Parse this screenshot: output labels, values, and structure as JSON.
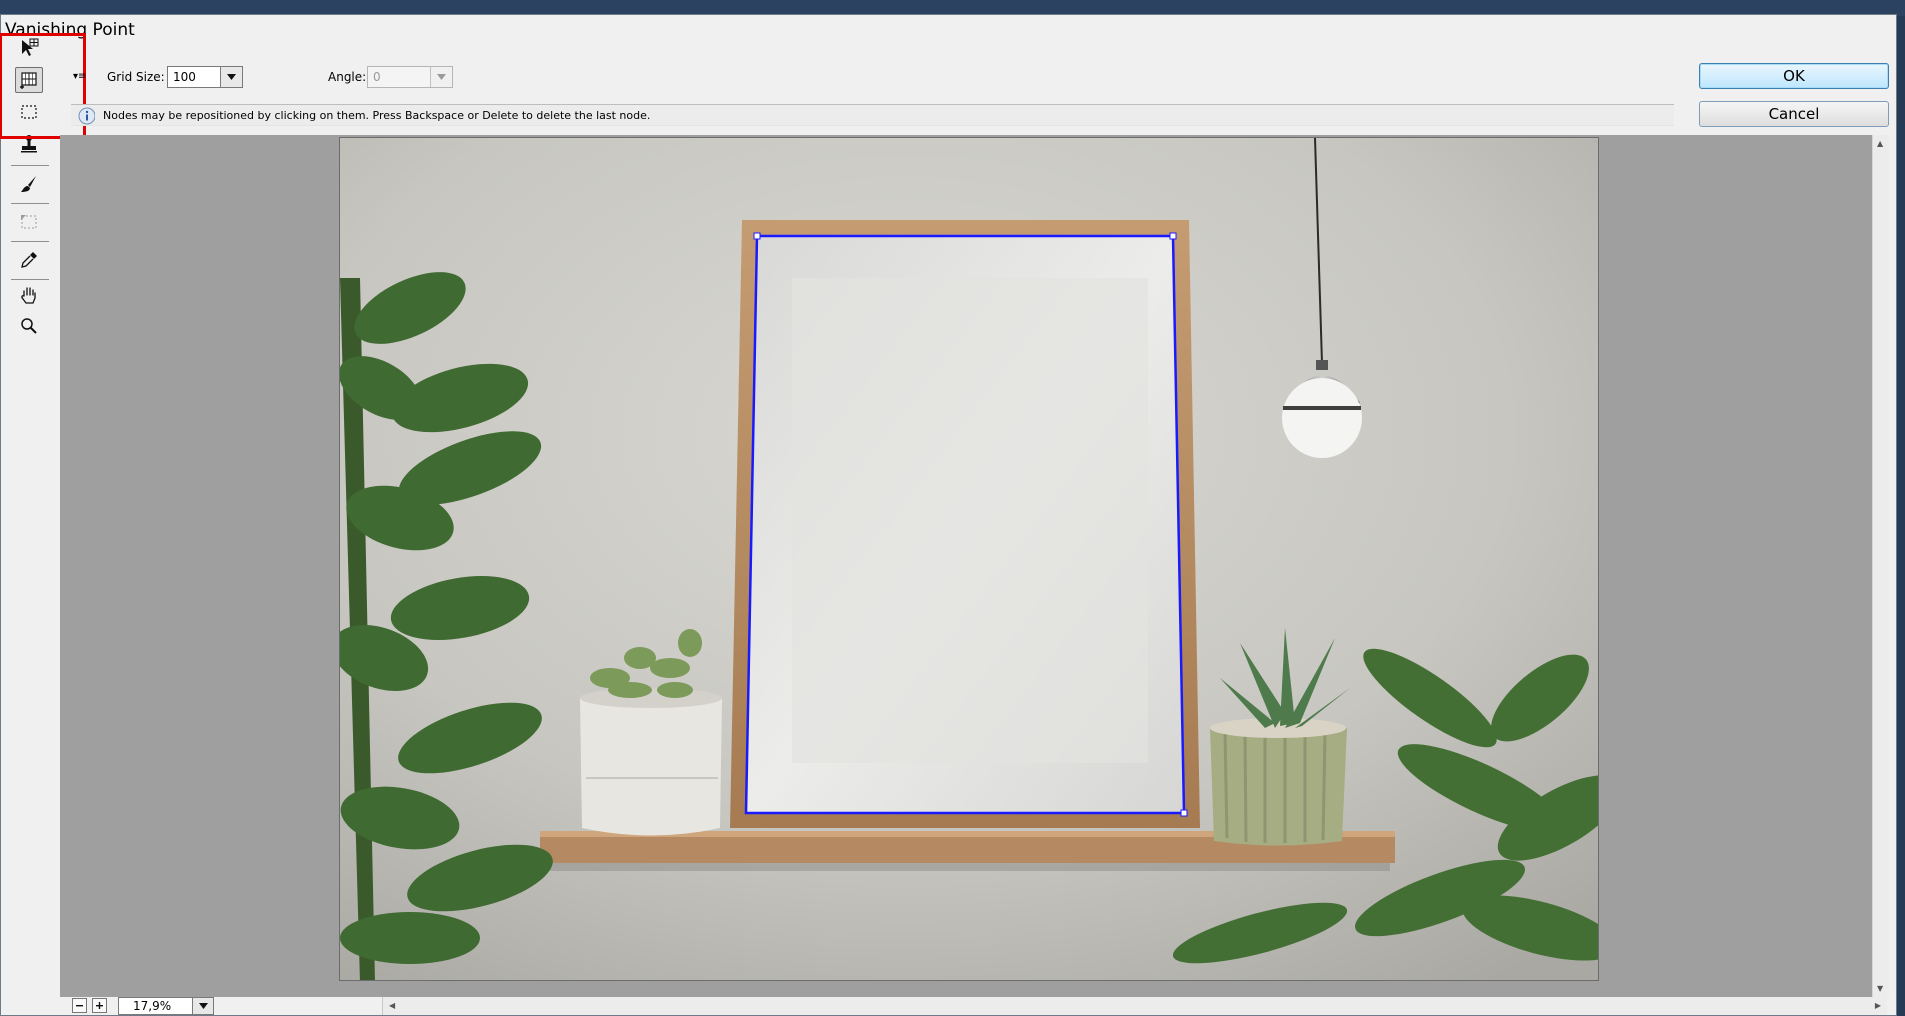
{
  "window": {
    "title": "Vanishing Point"
  },
  "tools": [
    {
      "name": "edit-plane-tool",
      "icon": "edit-plane-arrow-icon"
    },
    {
      "name": "create-plane-tool",
      "icon": "create-plane-icon",
      "active": true
    },
    {
      "name": "marquee-tool",
      "icon": "marquee-icon"
    },
    {
      "name": "stamp-tool",
      "icon": "stamp-icon"
    },
    {
      "name": "brush-tool",
      "icon": "brush-icon"
    },
    {
      "name": "transform-tool",
      "icon": "transform-icon"
    },
    {
      "name": "eyedropper-tool",
      "icon": "eyedropper-icon"
    },
    {
      "name": "hand-tool",
      "icon": "hand-icon"
    },
    {
      "name": "zoom-tool",
      "icon": "magnifier-icon"
    }
  ],
  "options": {
    "grid_size_label": "Grid Size:",
    "grid_size_value": "100",
    "angle_label": "Angle:",
    "angle_value": "0"
  },
  "info": {
    "message": "Nodes may be repositioned by clicking on them.  Press Backspace or Delete to delete the last node."
  },
  "buttons": {
    "ok": "OK",
    "cancel": "Cancel"
  },
  "status": {
    "zoom": "17,9%"
  },
  "colors": {
    "plane_outline": "#1a1aff",
    "highlight": "#e00000"
  }
}
